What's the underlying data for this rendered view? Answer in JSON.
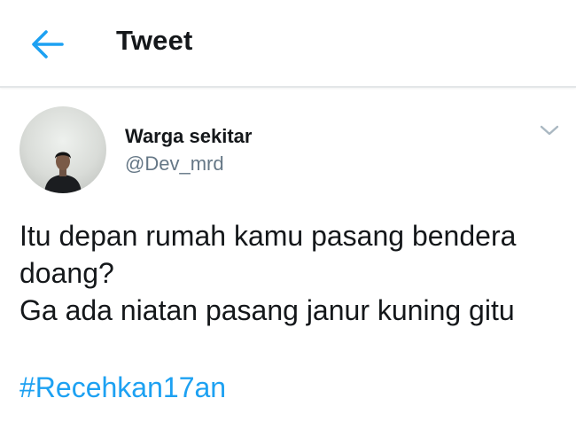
{
  "header": {
    "title": "Tweet",
    "back_icon": "arrow-left-icon",
    "accent_color": "#1da1f2"
  },
  "tweet": {
    "author": {
      "display_name": "Warga sekitar",
      "handle": "@Dev_mrd",
      "avatar_icon": "profile-photo"
    },
    "menu_icon": "chevron-down-icon",
    "text_lines": [
      "Itu depan rumah kamu pasang bendera",
      "doang?",
      "Ga ada niatan pasang janur kuning gitu"
    ],
    "hashtag": "#Recehkan17an"
  }
}
